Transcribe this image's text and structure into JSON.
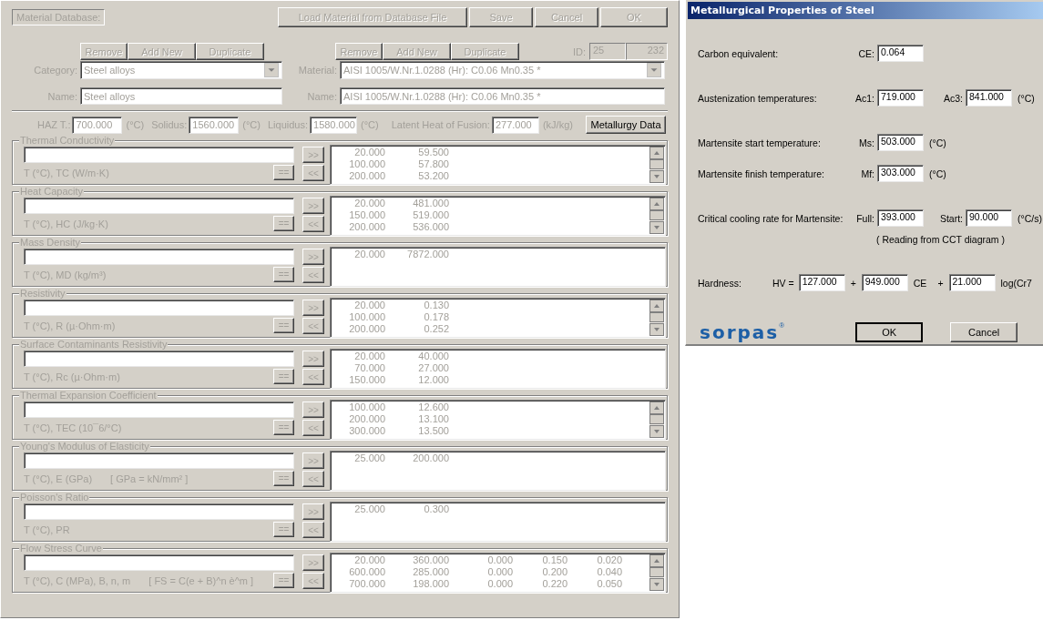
{
  "main": {
    "db_label": "Material Database:",
    "top_buttons": [
      {
        "label": "Load Material from Database File",
        "disabled": true
      },
      {
        "label": "Save",
        "disabled": true
      },
      {
        "label": "Cancel",
        "disabled": true
      },
      {
        "label": "OK",
        "disabled": true
      }
    ],
    "category_buttons": [
      {
        "label": "Remove",
        "disabled": true
      },
      {
        "label": "Add New",
        "disabled": true
      },
      {
        "label": "Duplicate",
        "disabled": true
      }
    ],
    "material_buttons": [
      {
        "label": "Remove",
        "disabled": true
      },
      {
        "label": "Add New",
        "disabled": true
      },
      {
        "label": "Duplicate",
        "disabled": true
      }
    ],
    "id_label": "ID:",
    "id_values": [
      "25",
      "232"
    ],
    "category": {
      "label": "Category:",
      "value": "Steel alloys"
    },
    "material": {
      "label": "Material:",
      "value": "AISI 1005/W.Nr.1.0288 (Hr): C0.06 Mn0.35 *"
    },
    "category_name": {
      "label": "Name:",
      "value": "Steel alloys"
    },
    "material_name": {
      "label": "Name:",
      "value": "AISI 1005/W.Nr.1.0288 (Hr): C0.06 Mn0.35 *"
    },
    "thermal_fields": [
      {
        "label": "HAZ  T.:",
        "value": "700.000",
        "unit": "(°C)"
      },
      {
        "label": "Solidus:",
        "value": "1560.000",
        "unit": "(°C)"
      },
      {
        "label": "Liquidus:",
        "value": "1580.000",
        "unit": "(°C)"
      },
      {
        "label": "Latent Heat of Fusion:",
        "value": "277.000",
        "unit": "(kJ/kg)"
      }
    ],
    "metallurgy_button": {
      "label": "Metallurgy Data",
      "disabled": false
    },
    "property_groups": [
      {
        "title": "Thermal Conductivity",
        "axis_label": "T (°C), TC (W/m·K)",
        "add_label": ">>",
        "set_label": "==",
        "remove_label": "<<",
        "scrollable": true,
        "rows": [
          [
            "20.000",
            "59.500"
          ],
          [
            "100.000",
            "57.800"
          ],
          [
            "200.000",
            "53.200"
          ]
        ]
      },
      {
        "title": "Heat Capacity",
        "axis_label": "T (°C), HC (J/kg·K)",
        "add_label": ">>",
        "set_label": "==",
        "remove_label": "<<",
        "scrollable": true,
        "rows": [
          [
            "20.000",
            "481.000"
          ],
          [
            "150.000",
            "519.000"
          ],
          [
            "200.000",
            "536.000"
          ]
        ]
      },
      {
        "title": "Mass Density",
        "axis_label": "T (°C), MD (kg/m³)",
        "add_label": ">>",
        "set_label": "==",
        "remove_label": "<<",
        "scrollable": false,
        "rows": [
          [
            "20.000",
            "7872.000"
          ]
        ]
      },
      {
        "title": "Resistivity",
        "axis_label": "T (°C), R (µ·Ohm·m)",
        "add_label": ">>",
        "set_label": "==",
        "remove_label": "<<",
        "scrollable": true,
        "rows": [
          [
            "20.000",
            "0.130"
          ],
          [
            "100.000",
            "0.178"
          ],
          [
            "200.000",
            "0.252"
          ]
        ]
      },
      {
        "title": "Surface Contaminants Resistivity",
        "axis_label": "T (°C), Rc (µ·Ohm·m)",
        "add_label": ">>",
        "set_label": "==",
        "remove_label": "<<",
        "scrollable": false,
        "rows": [
          [
            "20.000",
            "40.000"
          ],
          [
            "70.000",
            "27.000"
          ],
          [
            "150.000",
            "12.000"
          ]
        ]
      },
      {
        "title": "Thermal Expansion Coefficient",
        "axis_label": "T (°C), TEC (10¯6/°C)",
        "add_label": ">>",
        "set_label": "==",
        "remove_label": "<<",
        "scrollable": true,
        "rows": [
          [
            "100.000",
            "12.600"
          ],
          [
            "200.000",
            "13.100"
          ],
          [
            "300.000",
            "13.500"
          ]
        ]
      },
      {
        "title": "Young's Modulus of Elasticity",
        "axis_label": "T (°C), E (GPa)",
        "note": "[ GPa = kN/mm² ]",
        "add_label": ">>",
        "set_label": "==",
        "remove_label": "<<",
        "scrollable": false,
        "rows": [
          [
            "25.000",
            "200.000"
          ]
        ]
      },
      {
        "title": "Poisson's Ratio",
        "axis_label": "T (°C), PR",
        "add_label": ">>",
        "set_label": "==",
        "remove_label": "<<",
        "scrollable": false,
        "rows": [
          [
            "25.000",
            "0.300"
          ]
        ]
      },
      {
        "title": "Flow Stress Curve",
        "axis_label": "T (°C),  C (MPa),  B, n, m",
        "note": "[ FS = C(e + B)^n è^m ]",
        "add_label": ">>",
        "set_label": "==",
        "remove_label": "<<",
        "scrollable": true,
        "rows": [
          [
            "20.000",
            "360.000",
            "0.000",
            "0.150",
            "0.020"
          ],
          [
            "600.000",
            "285.000",
            "0.000",
            "0.200",
            "0.040"
          ],
          [
            "700.000",
            "198.000",
            "0.000",
            "0.220",
            "0.050"
          ]
        ]
      }
    ]
  },
  "dialog": {
    "title": "Metallurgical Properties of Steel",
    "rows": [
      {
        "kind": "fields",
        "label": "Carbon equivalent:",
        "fields": [
          {
            "label": "CE:",
            "value": "0.064"
          }
        ]
      },
      {
        "kind": "fields",
        "label": "Austenization temperatures:",
        "fields": [
          {
            "label": "Ac1:",
            "value": "719.000"
          },
          {
            "label": "Ac3:",
            "value": "841.000"
          }
        ],
        "unit": "(°C)"
      },
      {
        "kind": "fields",
        "label": "Martensite start temperature:",
        "fields": [
          {
            "label": "Ms:",
            "value": "503.000"
          }
        ],
        "unit": "(°C)"
      },
      {
        "kind": "fields",
        "label": "Martensite finish temperature:",
        "fields": [
          {
            "label": "Mf:",
            "value": "303.000"
          }
        ],
        "unit": "(°C)"
      },
      {
        "kind": "fields",
        "label": "Critical cooling rate for Martensite:",
        "fields": [
          {
            "label": "Full:",
            "value": "393.000"
          },
          {
            "label": "Start:",
            "value": "90.000"
          }
        ],
        "unit": "(°C/s)",
        "note": "( Reading from CCT diagram )"
      },
      {
        "kind": "formula",
        "label": "Hardness:",
        "parts": [
          {
            "kind": "text",
            "text": "HV ="
          },
          {
            "kind": "field",
            "value": "127.000"
          },
          {
            "kind": "text",
            "text": "+"
          },
          {
            "kind": "field",
            "value": "949.000"
          },
          {
            "kind": "text",
            "text": "CE"
          },
          {
            "kind": "text",
            "text": "+"
          },
          {
            "kind": "field",
            "value": "21.000"
          },
          {
            "kind": "text",
            "text": "log(Cr7"
          }
        ]
      }
    ],
    "logo": "sorpas",
    "logo_mark": "®",
    "buttons": [
      {
        "label": "OK",
        "default": true
      },
      {
        "label": "Cancel",
        "default": false
      }
    ]
  }
}
